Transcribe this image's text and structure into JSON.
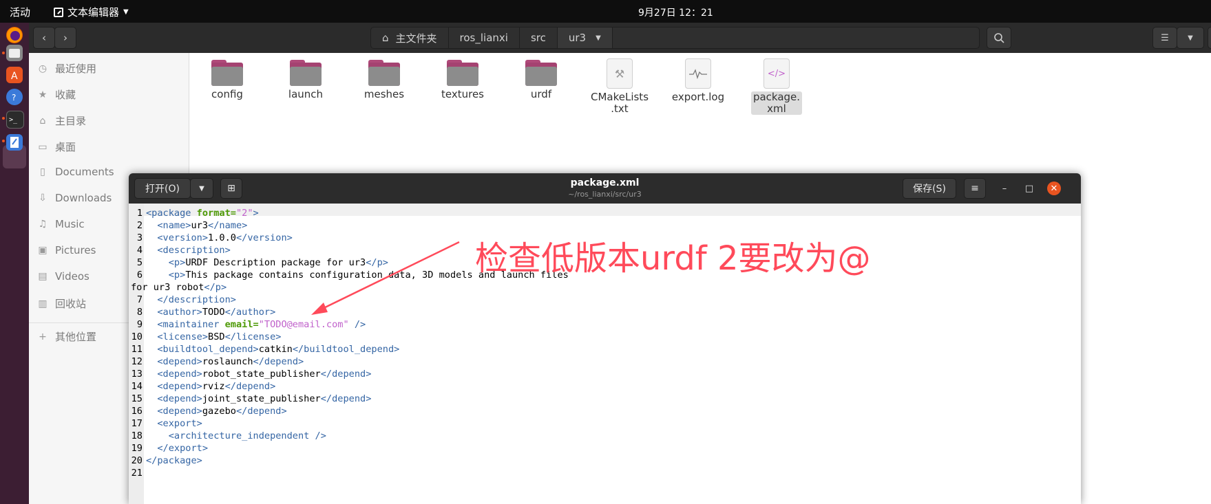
{
  "topbar": {
    "activities": "活动",
    "app_name": "文本编辑器",
    "clock": "9月27日 12：21"
  },
  "dock": {
    "items": [
      "firefox-icon",
      "files-icon",
      "software-icon",
      "help-icon",
      "terminal-icon",
      "text-editor-icon"
    ]
  },
  "file_manager": {
    "path": [
      "主文件夹",
      "ros_lianxi",
      "src",
      "ur3"
    ],
    "sidebar": [
      {
        "label": "最近使用",
        "icon": "clock-icon"
      },
      {
        "label": "收藏",
        "icon": "star-icon"
      },
      {
        "label": "主目录",
        "icon": "home-icon"
      },
      {
        "label": "桌面",
        "icon": "desktop-icon"
      },
      {
        "label": "Documents",
        "icon": "document-icon"
      },
      {
        "label": "Downloads",
        "icon": "download-icon"
      },
      {
        "label": "Music",
        "icon": "music-icon"
      },
      {
        "label": "Pictures",
        "icon": "picture-icon"
      },
      {
        "label": "Videos",
        "icon": "video-icon"
      },
      {
        "label": "回收站",
        "icon": "trash-icon"
      },
      {
        "label": "其他位置",
        "icon": "plus-icon"
      }
    ],
    "files": [
      {
        "name": "config",
        "type": "folder"
      },
      {
        "name": "launch",
        "type": "folder"
      },
      {
        "name": "meshes",
        "type": "folder"
      },
      {
        "name": "textures",
        "type": "folder"
      },
      {
        "name": "urdf",
        "type": "folder"
      },
      {
        "name": "CMakeLists\n.txt",
        "type": "cmake"
      },
      {
        "name": "export.log",
        "type": "log"
      },
      {
        "name": "package.\nxml",
        "type": "xml",
        "selected": true
      }
    ]
  },
  "editor": {
    "open_label": "打开(O)",
    "save_label": "保存(S)",
    "title": "package.xml",
    "subtitle": "~/ros_lianxi/src/ur3",
    "line_numbers": [
      "1",
      "2",
      "3",
      "4",
      "5",
      "6",
      "",
      "7",
      "8",
      "9",
      "10",
      "11",
      "12",
      "13",
      "14",
      "15",
      "16",
      "17",
      "18",
      "19",
      "20",
      "21"
    ],
    "lines": [
      "<package format=\"2\">",
      "  <name>ur3</name>",
      "  <version>1.0.0</version>",
      "  <description>",
      "    <p>URDF Description package for ur3</p>",
      "    <p>This package contains configuration data, 3D models and launch files",
      "for ur3 robot</p>",
      "  </description>",
      "  <author>TODO</author>",
      "  <maintainer email=\"TODO@email.com\" />",
      "  <license>BSD</license>",
      "  <buildtool_depend>catkin</buildtool_depend>",
      "  <depend>roslaunch</depend>",
      "  <depend>robot_state_publisher</depend>",
      "  <depend>rviz</depend>",
      "  <depend>joint_state_publisher</depend>",
      "  <depend>gazebo</depend>",
      "  <export>",
      "    <architecture_independent />",
      "  </export>",
      "</package>"
    ]
  },
  "annotation": {
    "text": "检查低版本urdf 2要改为@",
    "color": "#ff4a5a"
  }
}
